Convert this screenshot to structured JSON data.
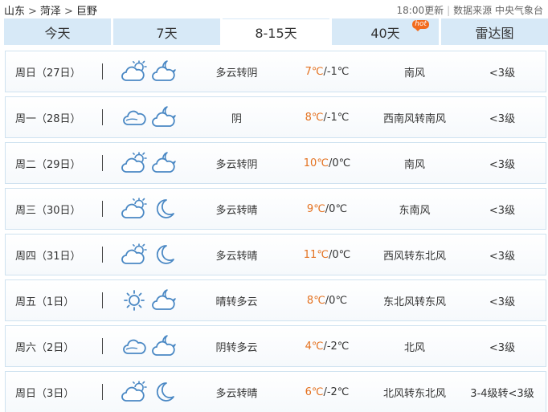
{
  "breadcrumb": {
    "province": "山东",
    "city": "菏泽",
    "county": "巨野",
    "separator": ">"
  },
  "meta": {
    "update": "18:00更新",
    "source": "数据来源 中央气象台"
  },
  "tabs": [
    {
      "label": "今天"
    },
    {
      "label": "7天"
    },
    {
      "label": "8-15天"
    },
    {
      "label": "40天",
      "badge": "hot"
    },
    {
      "label": "雷达图"
    }
  ],
  "active_tab": "8-15天",
  "colors": {
    "tab_bg": "#d7e9f7",
    "high_temp": "#e4711f",
    "hot_badge": "#f26b1d",
    "row_border": "#cfe2f0"
  },
  "days": [
    {
      "day": "周日（27日）",
      "icons": [
        "partly-cloudy-day-icon",
        "partly-cloudy-night-icon"
      ],
      "desc": "多云转阴",
      "high": "7℃",
      "low": "/-1℃",
      "wind": "南风",
      "level": "<3级"
    },
    {
      "day": "周一（28日）",
      "icons": [
        "cloudy-icon",
        "partly-cloudy-night-icon"
      ],
      "desc": "阴",
      "high": "8℃",
      "low": "/-1℃",
      "wind": "西南风转南风",
      "level": "<3级"
    },
    {
      "day": "周二（29日）",
      "icons": [
        "partly-cloudy-day-icon",
        "partly-cloudy-night-icon"
      ],
      "desc": "多云转阴",
      "high": "10℃",
      "low": "/0℃",
      "wind": "南风",
      "level": "<3级"
    },
    {
      "day": "周三（30日）",
      "icons": [
        "partly-cloudy-day-icon",
        "moon-icon"
      ],
      "desc": "多云转晴",
      "high": "9℃",
      "low": "/0℃",
      "wind": "东南风",
      "level": "<3级"
    },
    {
      "day": "周四（31日）",
      "icons": [
        "partly-cloudy-day-icon",
        "moon-icon"
      ],
      "desc": "多云转晴",
      "high": "11℃",
      "low": "/0℃",
      "wind": "西风转东北风",
      "level": "<3级"
    },
    {
      "day": "周五（1日）",
      "icons": [
        "sun-icon",
        "partly-cloudy-night-icon"
      ],
      "desc": "晴转多云",
      "high": "8℃",
      "low": "/0℃",
      "wind": "东北风转东风",
      "level": "<3级"
    },
    {
      "day": "周六（2日）",
      "icons": [
        "cloudy-icon",
        "partly-cloudy-night-icon"
      ],
      "desc": "阴转多云",
      "high": "4℃",
      "low": "/-2℃",
      "wind": "北风",
      "level": "<3级"
    },
    {
      "day": "周日（3日）",
      "icons": [
        "partly-cloudy-day-icon",
        "moon-icon"
      ],
      "desc": "多云转晴",
      "high": "6℃",
      "low": "/-2℃",
      "wind": "北风转东北风",
      "level": "3-4级转<3级"
    }
  ]
}
